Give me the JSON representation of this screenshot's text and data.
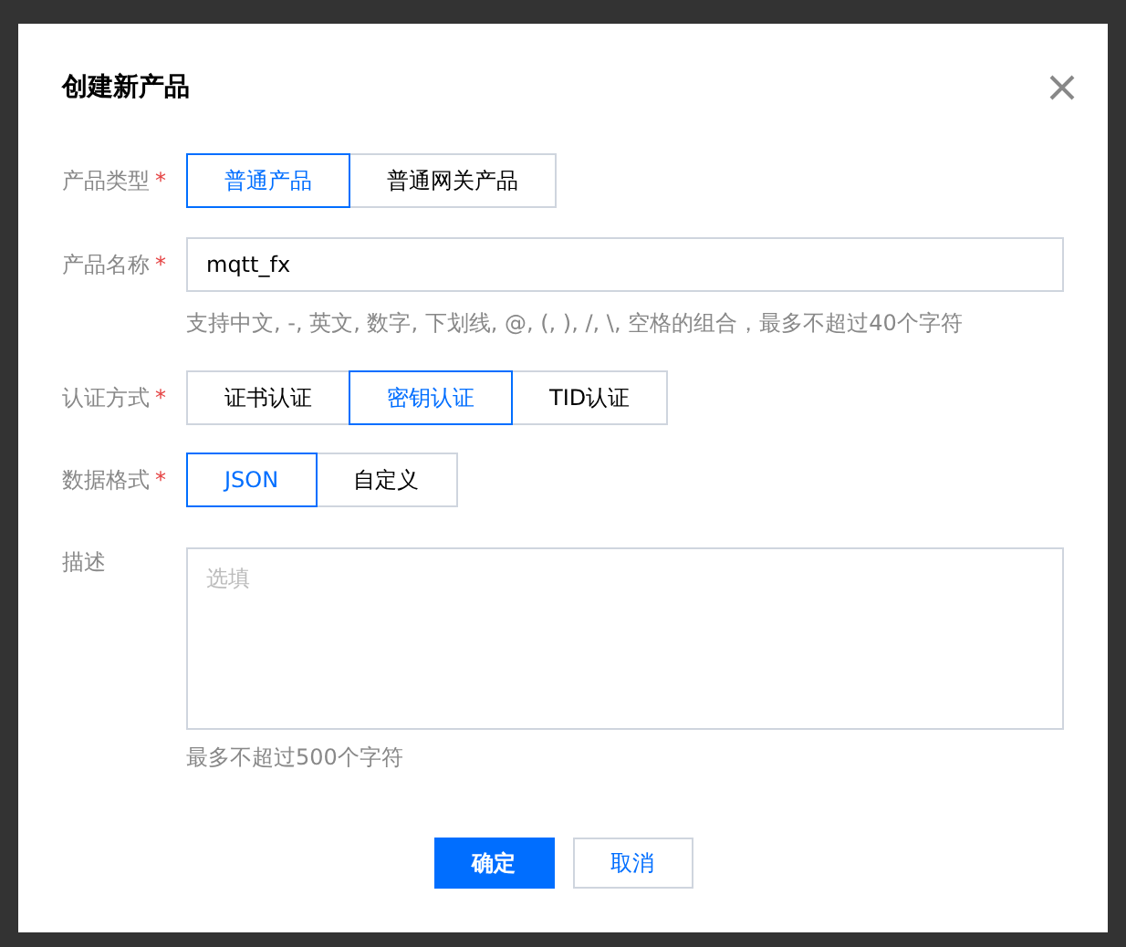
{
  "dialog": {
    "title": "创建新产品",
    "fields": [
      {
        "kind": "segmented",
        "label": "产品类型",
        "required_mark": "*",
        "options": [
          {
            "label": "普通产品",
            "selected": true
          },
          {
            "label": "普通网关产品",
            "selected": false
          }
        ]
      },
      {
        "kind": "text",
        "label": "产品名称",
        "required_mark": "*",
        "value": "mqtt_fx",
        "hint": "支持中文, -, 英文, 数字, 下划线, @, (, ), /, \\, 空格的组合，最多不超过40个字符"
      },
      {
        "kind": "segmented",
        "label": "认证方式",
        "required_mark": "*",
        "options": [
          {
            "label": "证书认证",
            "selected": false
          },
          {
            "label": "密钥认证",
            "selected": true
          },
          {
            "label": "TID认证",
            "selected": false
          }
        ]
      },
      {
        "kind": "segmented",
        "label": "数据格式",
        "required_mark": "*",
        "options": [
          {
            "label": "JSON",
            "selected": true
          },
          {
            "label": "自定义",
            "selected": false
          }
        ]
      },
      {
        "kind": "textarea",
        "label": "描述",
        "placeholder": "选填",
        "hint": "最多不超过500个字符"
      }
    ],
    "buttons": [
      {
        "label": "确定",
        "kind": "primary"
      },
      {
        "label": "取消",
        "kind": "secondary"
      }
    ]
  }
}
